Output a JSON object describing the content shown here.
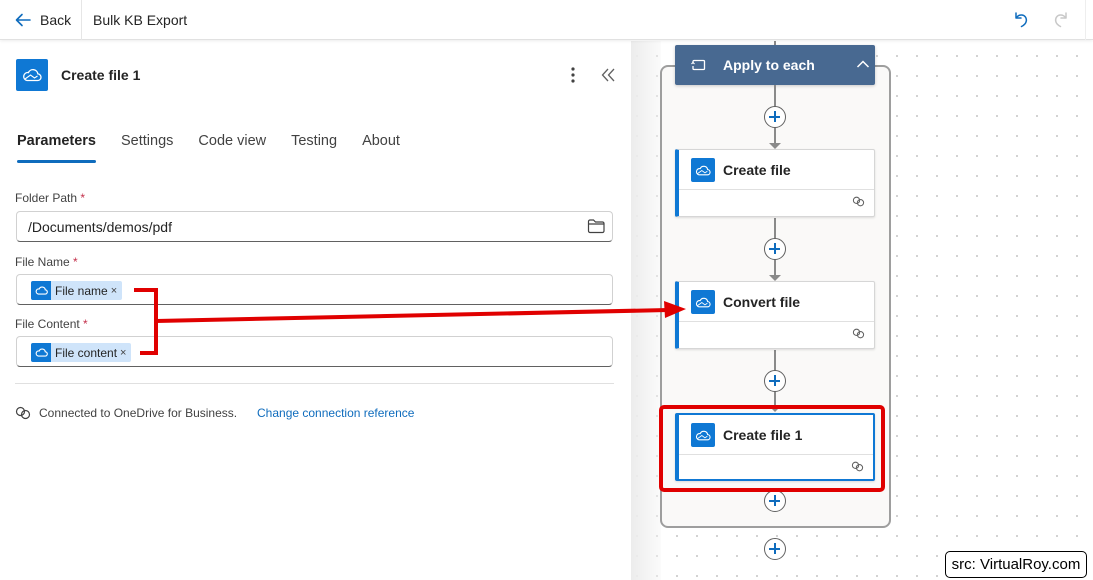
{
  "topbar": {
    "back_label": "Back",
    "flow_name": "Bulk KB Export",
    "undo_icon": "undo-icon",
    "redo_icon": "redo-icon"
  },
  "panel": {
    "title": "Create file 1",
    "icon": "onedrive-cloud-icon",
    "tabs": [
      {
        "label": "Parameters",
        "active": true
      },
      {
        "label": "Settings",
        "active": false
      },
      {
        "label": "Code view",
        "active": false
      },
      {
        "label": "Testing",
        "active": false
      },
      {
        "label": "About",
        "active": false
      }
    ],
    "fields": {
      "folder_path": {
        "label": "Folder Path",
        "required_mark": "*",
        "value": "/Documents/demos/pdf"
      },
      "file_name": {
        "label": "File Name",
        "required_mark": "*",
        "token": "File name",
        "token_remove": "×"
      },
      "file_content": {
        "label": "File Content",
        "required_mark": "*",
        "token": "File content",
        "token_remove": "×"
      }
    },
    "connection": {
      "status": "Connected to OneDrive for Business.",
      "change_link": "Change connection reference"
    }
  },
  "canvas": {
    "scope": {
      "title": "Apply to each"
    },
    "actions": [
      {
        "title": "Create file",
        "selected": false
      },
      {
        "title": "Convert file",
        "selected": false
      },
      {
        "title": "Create file 1",
        "selected": true
      }
    ]
  },
  "annotation": {
    "credit": "src: VirtualRoy.com",
    "highlight_color": "#e00000"
  },
  "colors": {
    "accent": "#0f6cbd",
    "onedrive_blue": "#0f78d4",
    "scope_header": "#486991"
  }
}
